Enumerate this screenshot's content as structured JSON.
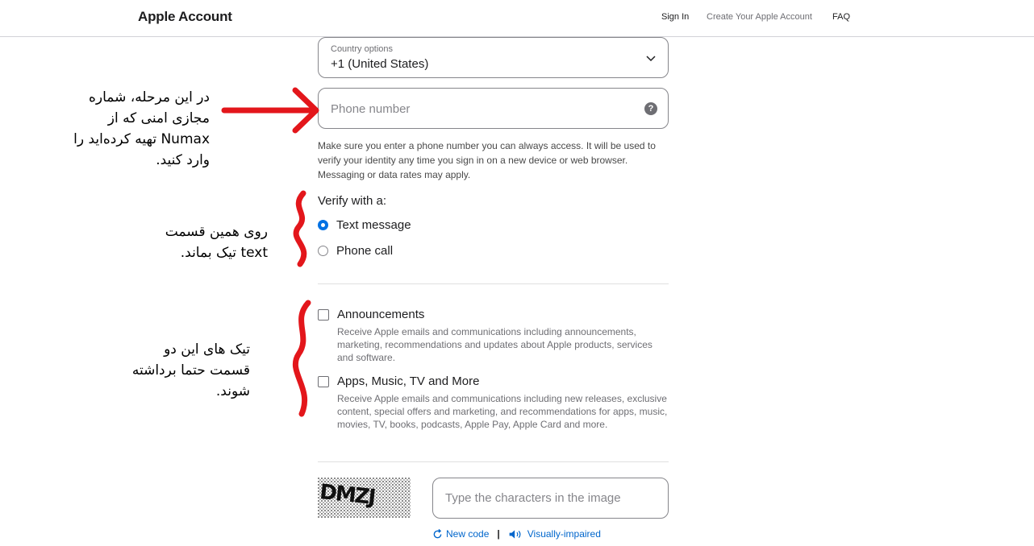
{
  "header": {
    "brand": "Apple Account",
    "nav": {
      "sign_in": "Sign In",
      "create": "Create Your Apple Account",
      "faq": "FAQ"
    }
  },
  "form": {
    "country": {
      "label": "Country options",
      "value": "+1 (United States)"
    },
    "phone": {
      "placeholder": "Phone number",
      "help": "?"
    },
    "note": "Make sure you enter a phone number you can always access. It will be used to verify your identity any time you sign in on a new device or web browser. Messaging or data rates may apply.",
    "verify": {
      "title": "Verify with a:",
      "options": [
        {
          "label": "Text message",
          "selected": true
        },
        {
          "label": "Phone call",
          "selected": false
        }
      ]
    },
    "subscriptions": [
      {
        "label": "Announcements",
        "checked": false,
        "desc": "Receive Apple emails and communications including announcements, marketing, recommendations and updates about Apple products, services and software."
      },
      {
        "label": "Apps, Music, TV and More",
        "checked": false,
        "desc": "Receive Apple emails and communications including new releases, exclusive content, special offers and marketing, and recommendations for apps, music, movies, TV, books, podcasts, Apple Pay, Apple Card and more."
      }
    ],
    "captcha": {
      "image_text": "DMZJ",
      "placeholder": "Type the characters in the image",
      "new_code": "New code",
      "separator": "|",
      "visually_impaired": "Visually-impaired"
    }
  },
  "annotations": {
    "a1": [
      "در این مرحله، شماره",
      "مجازی امنی که از",
      "Numax تهیه کرده‌اید را",
      "وارد کنید."
    ],
    "a2": [
      "روی همین قسمت",
      "text تیک بماند."
    ],
    "a3": [
      "تیک های این دو",
      "قسمت حتما برداشته",
      "شوند."
    ]
  },
  "colors": {
    "accent": "#0071e3",
    "link": "#0066cc",
    "annotation": "#e3161b"
  }
}
